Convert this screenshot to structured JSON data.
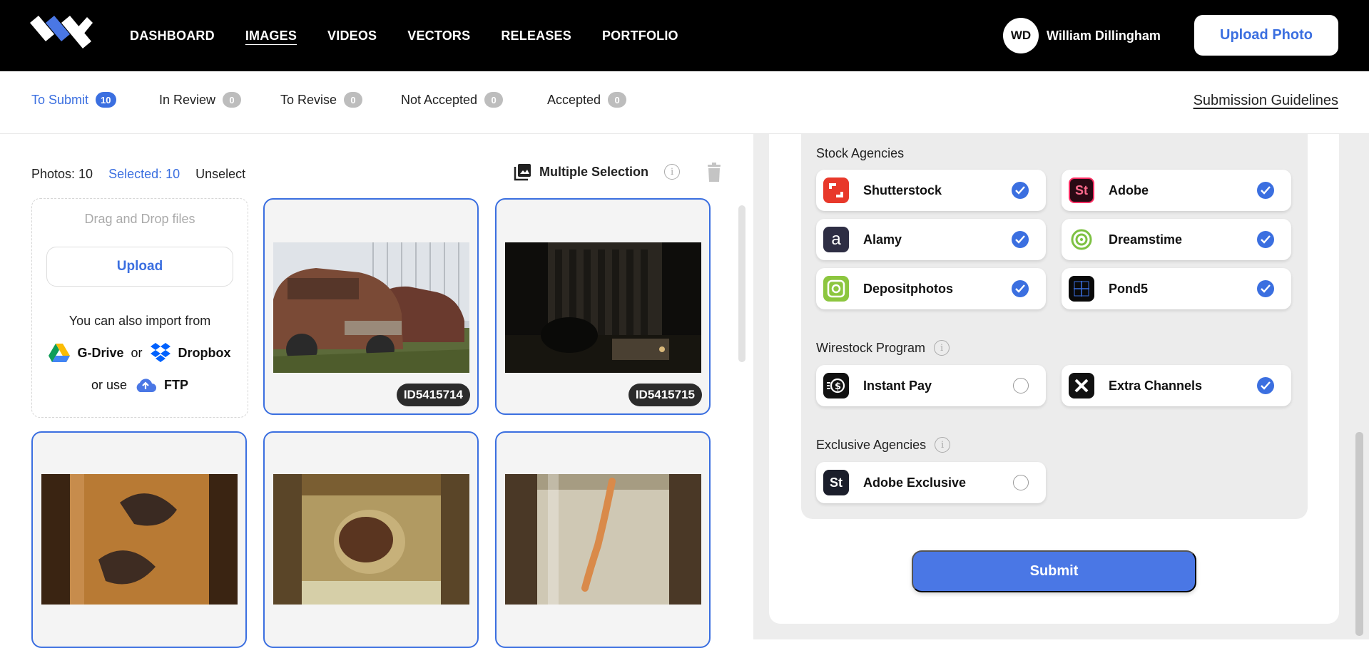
{
  "nav": {
    "items": [
      "DASHBOARD",
      "IMAGES",
      "VIDEOS",
      "VECTORS",
      "RELEASES",
      "PORTFOLIO"
    ],
    "active": "IMAGES"
  },
  "user": {
    "initials": "WD",
    "name": "William Dillingham"
  },
  "header": {
    "upload_label": "Upload Photo"
  },
  "tabs": [
    {
      "label": "To Submit",
      "count": "10"
    },
    {
      "label": "In Review",
      "count": "0"
    },
    {
      "label": "To Revise",
      "count": "0"
    },
    {
      "label": "Not Accepted",
      "count": "0"
    },
    {
      "label": "Accepted",
      "count": "0"
    }
  ],
  "guidelines_label": "Submission Guidelines",
  "stats": {
    "photos": "Photos: 10",
    "selected": "Selected: 10",
    "unselect": "Unselect"
  },
  "multi_selection_label": "Multiple Selection",
  "dropzone": {
    "title": "Drag and Drop files",
    "upload": "Upload",
    "import_text": "You can also import from",
    "gdrive": "G-Drive",
    "or": "or",
    "dropbox": "Dropbox",
    "or_use": "or use",
    "ftp": "FTP"
  },
  "photos": [
    {
      "id": "ID5415714",
      "subject": "rusty-cars"
    },
    {
      "id": "ID5415715",
      "subject": "building-night"
    },
    {
      "id": "",
      "subject": "fish-jar"
    },
    {
      "id": "",
      "subject": "specimen-jar"
    },
    {
      "id": "",
      "subject": "salamander-jar"
    }
  ],
  "sections": {
    "stock": "Stock Agencies",
    "wirestock": "Wirestock Program",
    "exclusive": "Exclusive Agencies"
  },
  "agencies": {
    "shutterstock": {
      "name": "Shutterstock",
      "checked": true,
      "color": "#e8382a"
    },
    "adobe": {
      "name": "Adobe",
      "checked": true,
      "color": "#2a0a14"
    },
    "alamy": {
      "name": "Alamy",
      "checked": true,
      "color": "#2e2e44"
    },
    "dreamstime": {
      "name": "Dreamstime",
      "checked": true,
      "color": "#7dc142"
    },
    "depositphotos": {
      "name": "Depositphotos",
      "checked": true,
      "color": "#8cc63f"
    },
    "pond5": {
      "name": "Pond5",
      "checked": true,
      "color": "#0a0a0a"
    },
    "instantpay": {
      "name": "Instant Pay",
      "checked": false,
      "color": "#111111"
    },
    "extrachannels": {
      "name": "Extra Channels",
      "checked": true,
      "color": "#111111"
    },
    "adobeexclusive": {
      "name": "Adobe Exclusive",
      "checked": false,
      "color": "#1b1e2b"
    }
  },
  "submit_label": "Submit",
  "accent_color": "#3b6fe0"
}
